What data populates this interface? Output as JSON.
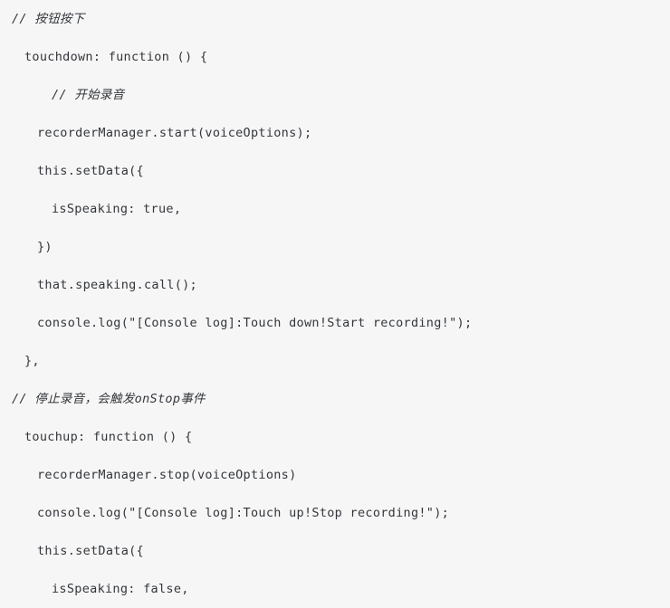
{
  "code_block": {
    "language": "javascript",
    "background_color": "#f6f6f6",
    "text_color": "#33363b",
    "lines": [
      {
        "id": "line-1",
        "indent": 0,
        "kind": "comment",
        "text": "// 按钮按下"
      },
      {
        "id": "line-2",
        "indent": 1,
        "kind": "code",
        "text": "touchdown: function () {"
      },
      {
        "id": "line-3",
        "indent": 3,
        "kind": "comment",
        "text": "// 开始录音"
      },
      {
        "id": "line-4",
        "indent": 2,
        "kind": "code",
        "text": "recorderManager.start(voiceOptions);"
      },
      {
        "id": "line-5",
        "indent": 2,
        "kind": "code",
        "text": "this.setData({"
      },
      {
        "id": "line-6",
        "indent": 3,
        "kind": "code",
        "text": "isSpeaking: true,"
      },
      {
        "id": "line-7",
        "indent": 2,
        "kind": "code",
        "text": "})"
      },
      {
        "id": "line-8",
        "indent": 2,
        "kind": "code",
        "text": "that.speaking.call();"
      },
      {
        "id": "line-9",
        "indent": 2,
        "kind": "code",
        "text": "console.log(\"[Console log]:Touch down!Start recording!\");"
      },
      {
        "id": "line-10",
        "indent": 1,
        "kind": "code",
        "text": "},"
      },
      {
        "id": "line-11",
        "indent": 0,
        "kind": "comment",
        "text": "// 停止录音，会触发onStop事件"
      },
      {
        "id": "line-12",
        "indent": 1,
        "kind": "code",
        "text": "touchup: function () {"
      },
      {
        "id": "line-13",
        "indent": 2,
        "kind": "code",
        "text": "recorderManager.stop(voiceOptions)"
      },
      {
        "id": "line-14",
        "indent": 2,
        "kind": "code",
        "text": "console.log(\"[Console log]:Touch up!Stop recording!\");"
      },
      {
        "id": "line-15",
        "indent": 2,
        "kind": "code",
        "text": "this.setData({"
      },
      {
        "id": "line-16",
        "indent": 3,
        "kind": "code",
        "text": "isSpeaking: false,"
      }
    ]
  }
}
